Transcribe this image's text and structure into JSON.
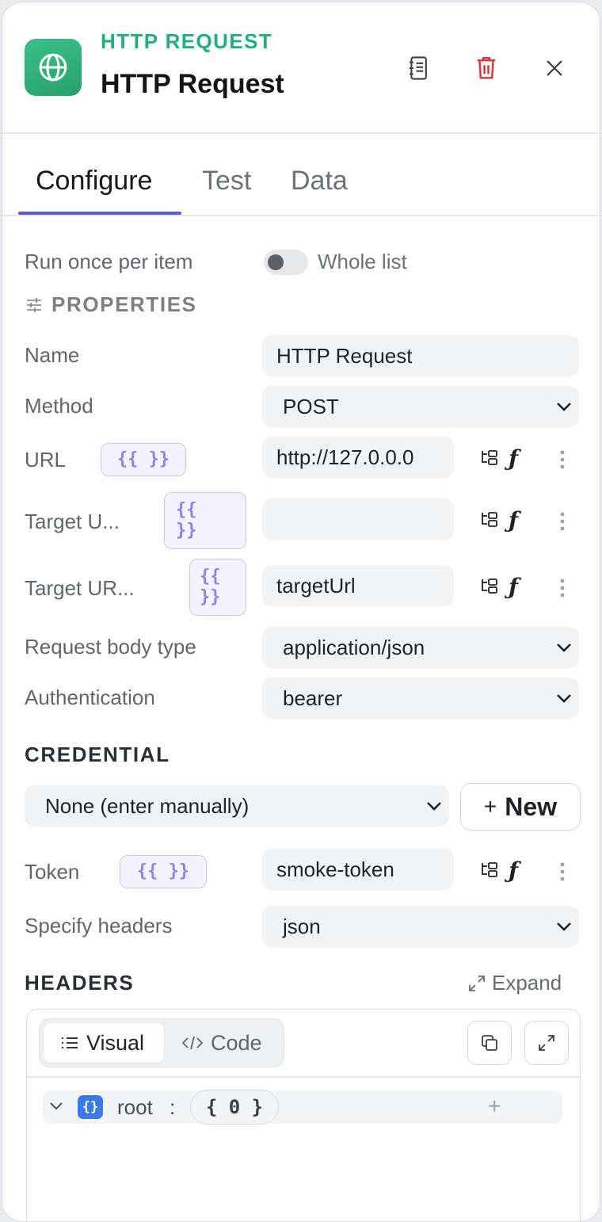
{
  "header": {
    "kicker": "HTTP REQUEST",
    "title": "HTTP Request"
  },
  "tabs": [
    {
      "label": "Configure",
      "active": true
    },
    {
      "label": "Test",
      "active": false
    },
    {
      "label": "Data",
      "active": false
    }
  ],
  "run_mode": {
    "label": "Run once per item",
    "toggle_label": "Whole list",
    "enabled": false
  },
  "properties": {
    "section_title": "PROPERTIES",
    "name": {
      "label": "Name",
      "value": "HTTP Request"
    },
    "method": {
      "label": "Method",
      "value": "POST"
    },
    "url": {
      "label": "URL",
      "expr": "{{ }}",
      "value": "http://127.0.0.0"
    },
    "target_u": {
      "label": "Target U...",
      "expr": "{{\n}}",
      "value": ""
    },
    "target_ur": {
      "label": "Target UR...",
      "expr": "{{\n}}",
      "value": "targetUrl"
    },
    "body_type": {
      "label": "Request body type",
      "value": "application/json"
    },
    "auth": {
      "label": "Authentication",
      "value": "bearer"
    }
  },
  "credential": {
    "section_title": "CREDENTIAL",
    "selected": "None (enter manually)",
    "new_label": "New"
  },
  "token": {
    "label": "Token",
    "expr": "{{ }}",
    "value": "smoke-token"
  },
  "specify_headers": {
    "label": "Specify headers",
    "value": "json"
  },
  "headers": {
    "section_title": "HEADERS",
    "expand_label": "Expand",
    "modes": {
      "visual": "Visual",
      "code": "Code"
    },
    "root_key": "root",
    "colon": ":",
    "count": "{ 0 }"
  },
  "colors": {
    "accent": "#5b5bd6",
    "brand_green": "#22b07a",
    "delete_red": "#d9363e",
    "json_blue": "#3a7ae8"
  },
  "icons": [
    "globe-icon",
    "notebook-icon",
    "trash-icon",
    "close-icon",
    "sliders-icon",
    "chevron-down-icon",
    "tree-map-icon",
    "function-icon",
    "kebab-icon",
    "plus-icon",
    "expand-icon",
    "list-icon",
    "code-icon",
    "copy-icon",
    "fullscreen-icon"
  ]
}
